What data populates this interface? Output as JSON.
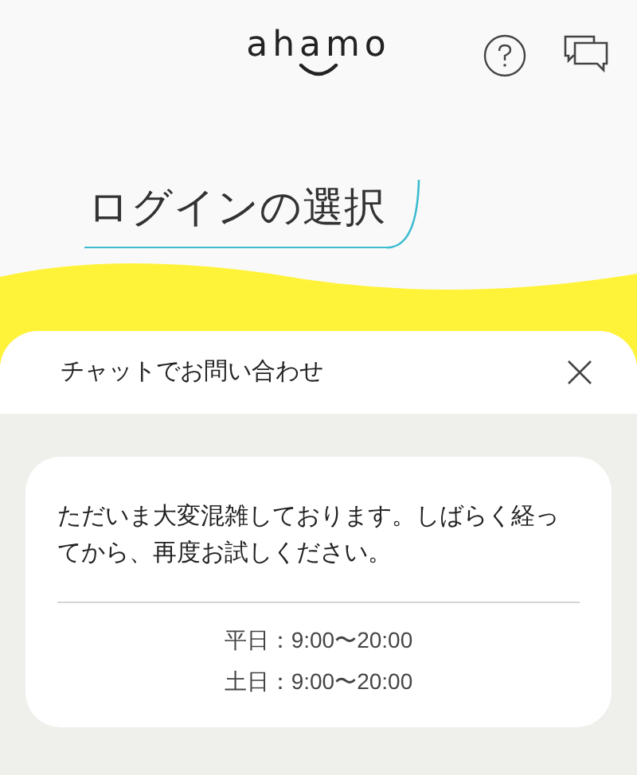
{
  "header": {
    "logo": "ahamo"
  },
  "page_title": "ログインの選択",
  "chat_panel": {
    "title": "チャットでお問い合わせ",
    "message": "ただいま大変混雑しております。しばらく経ってから、再度お試しください。",
    "hours": [
      {
        "label": "平日：9:00〜20:00"
      },
      {
        "label": "土日：9:00〜20:00"
      }
    ]
  }
}
